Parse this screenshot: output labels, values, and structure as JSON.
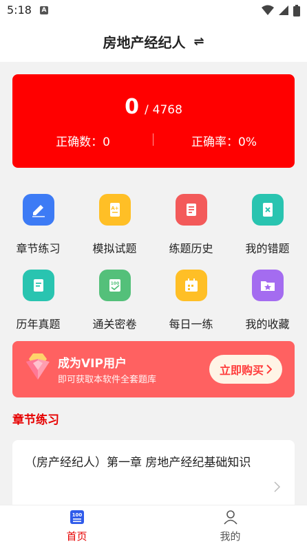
{
  "status_bar": {
    "time": "5:18",
    "notif_icon": "A"
  },
  "header": {
    "title": "房地产经纪人",
    "swap_icon": "⇌"
  },
  "score": {
    "current": "0",
    "separator": "/",
    "total": "4768",
    "correct_label": "正确数：0",
    "rate_label": "正确率：0%"
  },
  "menu": [
    {
      "label": "章节练习",
      "icon": "pen-icon",
      "color": "#3d7bf5"
    },
    {
      "label": "模拟试题",
      "icon": "exam-paper-icon",
      "color": "#ffbf26"
    },
    {
      "label": "练题历史",
      "icon": "notebook-icon",
      "color": "#f35a5a"
    },
    {
      "label": "我的错题",
      "icon": "wrong-book-icon",
      "color": "#29c4b0"
    },
    {
      "label": "历年真题",
      "icon": "document-icon",
      "color": "#29c4b0"
    },
    {
      "label": "通关密卷",
      "icon": "score-100-icon",
      "color": "#54c07a"
    },
    {
      "label": "每日一练",
      "icon": "calendar-icon",
      "color": "#ffbf26"
    },
    {
      "label": "我的收藏",
      "icon": "star-folder-icon",
      "color": "#a46cf0"
    }
  ],
  "vip": {
    "title": "成为VIP用户",
    "subtitle": "即可获取本软件全套题库",
    "button": "立即购买"
  },
  "section": {
    "title": "章节练习"
  },
  "chapters": [
    {
      "title": "（房产经纪人）第一章 房地产经纪基础知识"
    }
  ],
  "tabs": {
    "home": "首页",
    "home_icon_text": "100",
    "mine": "我的"
  },
  "colors": {
    "accent": "#ff0000",
    "vip_bg": "#ff6161",
    "section_red": "#e60000"
  }
}
